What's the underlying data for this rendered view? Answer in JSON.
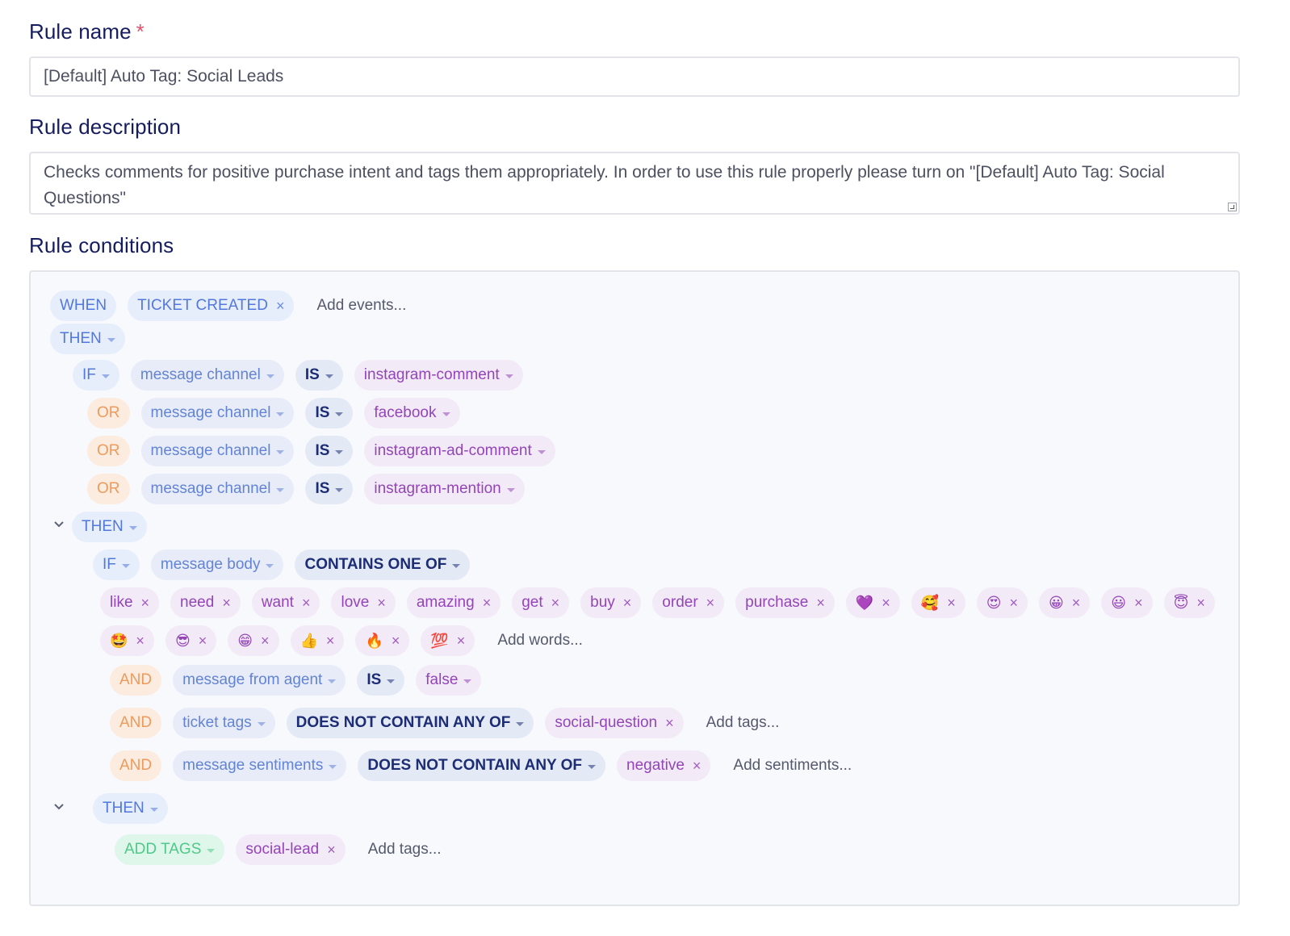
{
  "form": {
    "name_label": "Rule name",
    "required_mark": "*",
    "name_value": "[Default] Auto Tag: Social Leads",
    "description_label": "Rule description",
    "description_value": "Checks comments for positive purchase intent and tags them appropriately. In order to use this rule properly please turn on \"[Default] Auto Tag: Social Questions\"",
    "conditions_label": "Rule conditions"
  },
  "rule": {
    "when": "WHEN",
    "event": "TICKET CREATED",
    "add_events": "Add events...",
    "then": "THEN",
    "if": "IF",
    "or": "OR",
    "and": "AND",
    "is": "IS",
    "channel_field": "message channel",
    "channels": [
      "instagram-comment",
      "facebook",
      "instagram-ad-comment",
      "instagram-mention"
    ],
    "body_field": "message body",
    "contains_one_of": "CONTAINS ONE OF",
    "words": [
      "like",
      "need",
      "want",
      "love",
      "amazing",
      "get",
      "buy",
      "order",
      "purchase",
      "💜",
      "🥰",
      "😍",
      "😀",
      "😃",
      "😇",
      "🤩",
      "😎",
      "😁",
      "👍",
      "🔥",
      "💯"
    ],
    "add_words": "Add words...",
    "agent_field": "message from agent",
    "agent_value": "false",
    "tags_field": "ticket tags",
    "does_not_contain_any_of": "DOES NOT CONTAIN ANY OF",
    "excluded_tag": "social-question",
    "add_tags": "Add tags...",
    "sentiments_field": "message sentiments",
    "excluded_sentiment": "negative",
    "add_sentiments": "Add sentiments...",
    "action": "ADD TAGS",
    "action_tag": "social-lead"
  },
  "colors": {
    "label": "#161d5e",
    "keyword": "#5378dc",
    "operator": "#1c2d75",
    "value": "#9345b8",
    "or_and": "#ee9a5c",
    "action": "#4fc98a"
  }
}
